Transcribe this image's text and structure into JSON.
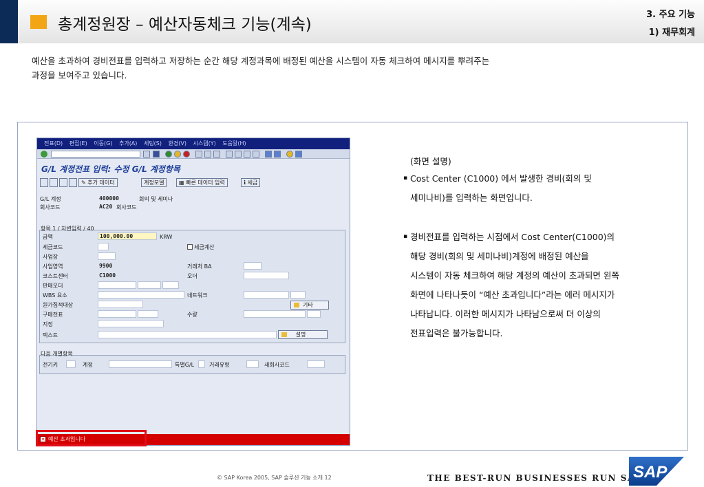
{
  "header": {
    "title": "총계정원장 – 예산자동체크 기능(계속)",
    "section": "3. 주요 기능",
    "subsection": "1) 재무회계"
  },
  "intro": {
    "line1": "예산을 초과하여 경비전표를 입력하고 저장하는 순간 해당 계정과목에 배정된 예산을 시스템이 자동 체크하여 메시지를 뿌려주는",
    "line2": "과정을 보여주고 있습니다."
  },
  "sap_screen": {
    "menu": [
      "전표(D)",
      "편집(E)",
      "이동(G)",
      "추가(A)",
      "세팅(S)",
      "환경(V)",
      "시스템(Y)",
      "도움말(H)"
    ],
    "title": "G/L 계정전표 입력: 수정 G/L 계정항목",
    "app_toolbar": {
      "more_data": "추가 데이터",
      "account_model": "계정모델",
      "fast_data_entry": "빠른 데이터 입력",
      "tax": "세금"
    },
    "gl_account_label": "G/L 계정",
    "gl_account_value": "400000",
    "gl_account_text": "회의 및 세미나",
    "company_code_label": "회사코드",
    "company_code_value": "AC20",
    "company_code_text": "회사코드",
    "item_tab": "항목 1 / 차변입력 / 40",
    "amount_label": "금액",
    "amount_value": "100,000.00",
    "currency": "KRW",
    "tax_code_label": "세금코드",
    "calc_tax_label": "세금계산",
    "business_place_label": "사업장",
    "business_area_label": "사업영역",
    "business_area_value": "9900",
    "trading_partner_label": "거래처 BA",
    "cost_center_label": "코스트센터",
    "cost_center_value": "C1000",
    "order_label": "오더",
    "sales_order_label": "판매오더",
    "wbs_label": "WBS 요소",
    "network_label": "네트워크",
    "cost_object_label": "원가집적대상",
    "more_button": "기타",
    "purchase_doc_label": "구매전표",
    "quantity_label": "수량",
    "assignment_label": "지정",
    "text_label": "텍스트",
    "explain_button": "설명",
    "next_item_tab": "다음 개별항목",
    "posting_key_label": "전기키",
    "account_label": "계정",
    "special_gl_label": "특별G/L",
    "transaction_type_label": "거래유형",
    "new_company_label": "새회사코드",
    "status_message": "예산 초과입니다"
  },
  "description": {
    "heading": "(화면 설명)",
    "b1_l1": "Cost Center (C1000) 에서 발생한 경비(회의 및",
    "b1_l2": "세미나비)를 입력하는 화면입니다.",
    "b2_l1": "경비전표를 입력하는 시점에서 Cost Center(C1000)의",
    "b2_l2": "해당 경비(회의 및 세미나비)계정에 배정된 예산을",
    "b2_l3": "시스템이 자동 체크하여 해당 계정의 예산이 초과되면 왼쪽",
    "b2_l4": "화면에 나타나듯이 “예산 초과입니다”라는 에러 메시지가",
    "b2_l5": "나타납니다. 이러한 메시지가 나타남으로써 더 이상의",
    "b2_l6": "전표입력은 불가능합니다.",
    "bullet": "▪"
  },
  "footer": {
    "copyright": "© SAP Korea 2005, SAP 솔루션 기능 소개 12",
    "slogan": "THE BEST-RUN BUSINESSES RUN SAP",
    "logo": "SAP"
  },
  "colors": {
    "accent": "#f2a515",
    "navy": "#0d2b57",
    "sap_menu": "#11207c",
    "error": "#d40000"
  }
}
